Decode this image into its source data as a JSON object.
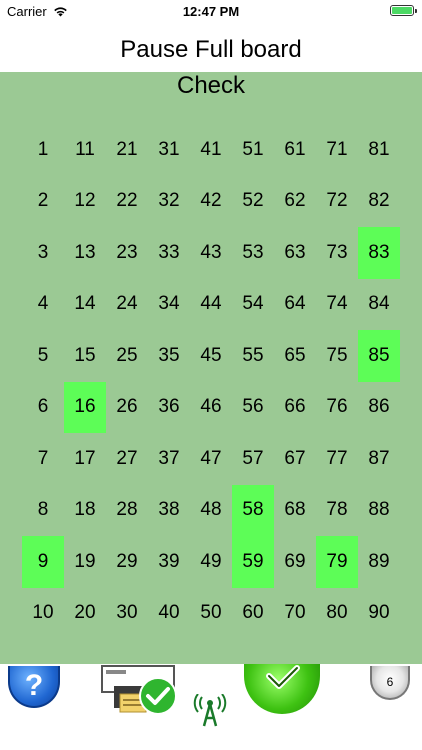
{
  "status_bar": {
    "carrier": "Carrier",
    "time": "12:47 PM"
  },
  "header": {
    "title": "Pause Full board"
  },
  "board": {
    "check_label": "Check",
    "columns": [
      [
        "1",
        "2",
        "3",
        "4",
        "5",
        "6",
        "7",
        "8",
        "9",
        "10"
      ],
      [
        "11",
        "12",
        "13",
        "14",
        "15",
        "16",
        "17",
        "18",
        "19",
        "20"
      ],
      [
        "21",
        "22",
        "23",
        "24",
        "25",
        "26",
        "27",
        "28",
        "29",
        "30"
      ],
      [
        "31",
        "32",
        "33",
        "34",
        "35",
        "36",
        "37",
        "38",
        "39",
        "40"
      ],
      [
        "41",
        "42",
        "43",
        "44",
        "45",
        "46",
        "47",
        "48",
        "49",
        "50"
      ],
      [
        "51",
        "52",
        "53",
        "54",
        "55",
        "56",
        "57",
        "58",
        "59",
        "60"
      ],
      [
        "61",
        "62",
        "63",
        "64",
        "65",
        "66",
        "67",
        "68",
        "69",
        "70"
      ],
      [
        "71",
        "72",
        "73",
        "74",
        "75",
        "76",
        "77",
        "78",
        "79",
        "80"
      ],
      [
        "81",
        "82",
        "83",
        "84",
        "85",
        "86",
        "87",
        "88",
        "89",
        "90"
      ]
    ],
    "marked": [
      "9",
      "16",
      "58",
      "59",
      "79",
      "83",
      "85"
    ],
    "marked_color": "#5dfd57",
    "background_color": "#9bc994"
  },
  "toolbar": {
    "help_icon": "?",
    "counter_value": "6",
    "icons": [
      "help-icon",
      "save-check-icon",
      "antenna-icon",
      "check-button-icon",
      "counter-icon"
    ]
  }
}
